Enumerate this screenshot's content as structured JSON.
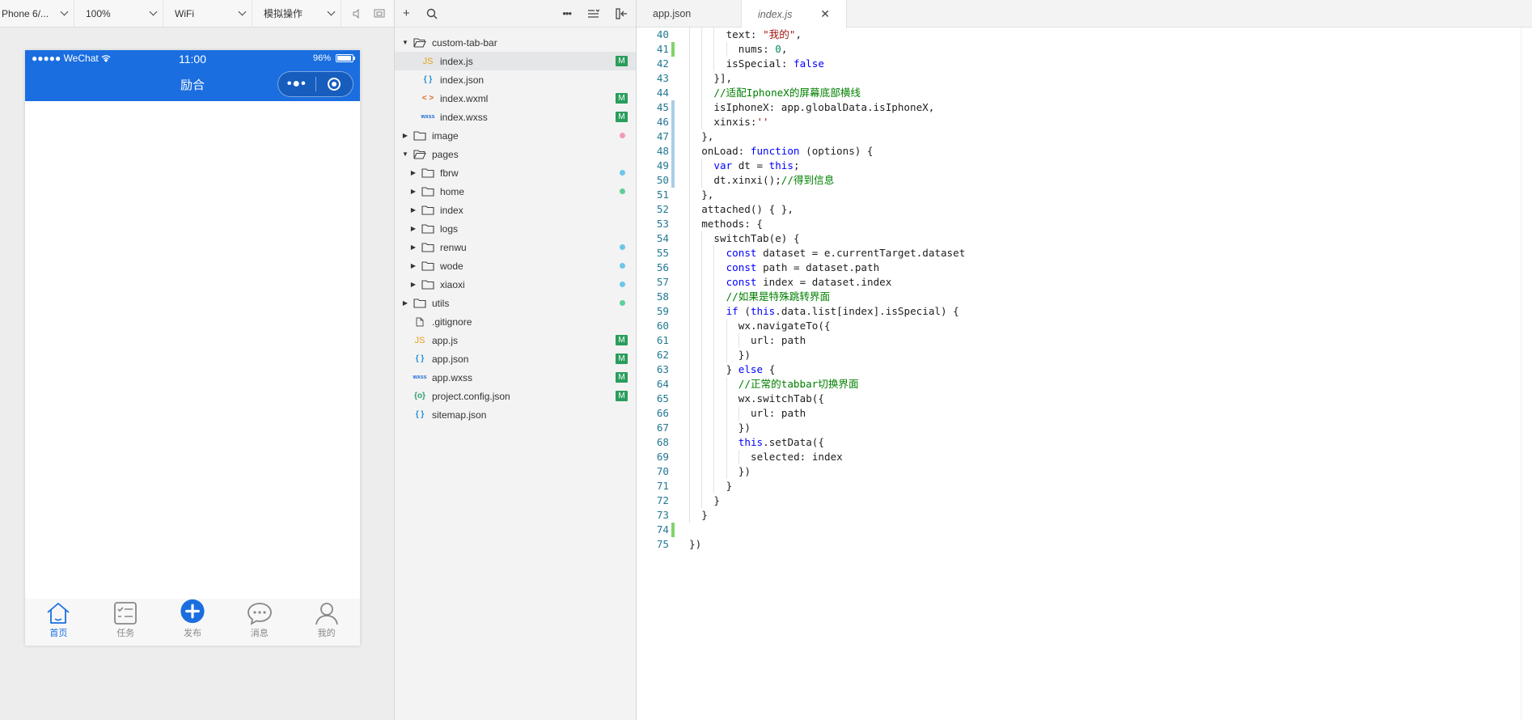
{
  "simulator": {
    "device": "Phone 6/...",
    "zoom": "100%",
    "network": "WiFi",
    "mode": "模拟操作",
    "status_bar": {
      "carrier": "●●●●● WeChat",
      "time": "11:00",
      "battery": "96%"
    },
    "nav_title": "励合",
    "tabbar": [
      {
        "label": "首页",
        "icon": "home-icon",
        "active": true
      },
      {
        "label": "任务",
        "icon": "task-list-icon",
        "active": false
      },
      {
        "label": "发布",
        "icon": "plus-circle-icon",
        "active": false,
        "special": true
      },
      {
        "label": "消息",
        "icon": "chat-bubble-icon",
        "active": false
      },
      {
        "label": "我的",
        "icon": "user-icon",
        "active": false
      }
    ]
  },
  "explorer": {
    "tree": [
      {
        "name": "custom-tab-bar",
        "type": "folder",
        "depth": 0,
        "open": true
      },
      {
        "name": "index.js",
        "type": "js",
        "depth": 1,
        "badge": "M",
        "selected": true
      },
      {
        "name": "index.json",
        "type": "json",
        "depth": 1
      },
      {
        "name": "index.wxml",
        "type": "wxml",
        "depth": 1,
        "badge": "M"
      },
      {
        "name": "index.wxss",
        "type": "wxss",
        "depth": 1,
        "badge": "M"
      },
      {
        "name": "image",
        "type": "folder",
        "depth": 0,
        "open": false,
        "dot": "#f29bb4"
      },
      {
        "name": "pages",
        "type": "folder",
        "depth": 0,
        "open": true
      },
      {
        "name": "fbrw",
        "type": "folder",
        "depth": 1,
        "open": false,
        "dot": "#6ec6e8"
      },
      {
        "name": "home",
        "type": "folder",
        "depth": 1,
        "open": false,
        "dot": "#5fcf9a"
      },
      {
        "name": "index",
        "type": "folder",
        "depth": 1,
        "open": false
      },
      {
        "name": "logs",
        "type": "folder",
        "depth": 1,
        "open": false
      },
      {
        "name": "renwu",
        "type": "folder",
        "depth": 1,
        "open": false,
        "dot": "#6ec6e8"
      },
      {
        "name": "wode",
        "type": "folder",
        "depth": 1,
        "open": false,
        "dot": "#6ec6e8"
      },
      {
        "name": "xiaoxi",
        "type": "folder",
        "depth": 1,
        "open": false,
        "dot": "#6ec6e8"
      },
      {
        "name": "utils",
        "type": "folder",
        "depth": 0,
        "open": false,
        "dot": "#5fcf9a"
      },
      {
        "name": ".gitignore",
        "type": "doc",
        "depth": 0
      },
      {
        "name": "app.js",
        "type": "js",
        "depth": 0,
        "badge": "M"
      },
      {
        "name": "app.json",
        "type": "json",
        "depth": 0,
        "badge": "M"
      },
      {
        "name": "app.wxss",
        "type": "wxss",
        "depth": 0,
        "badge": "M"
      },
      {
        "name": "project.config.json",
        "type": "config",
        "depth": 0,
        "badge": "M"
      },
      {
        "name": "sitemap.json",
        "type": "json",
        "depth": 0
      }
    ]
  },
  "editor": {
    "tabs": [
      {
        "label": "app.json",
        "active": false
      },
      {
        "label": "index.js",
        "active": true
      }
    ],
    "lines": [
      {
        "n": 40,
        "indent": 6,
        "mark": "",
        "tokens": [
          [
            "text: ",
            "p"
          ],
          [
            "\"我的\"",
            "s"
          ],
          [
            ",",
            "p"
          ]
        ]
      },
      {
        "n": 41,
        "indent": 8,
        "mark": "add",
        "tokens": [
          [
            "nums: ",
            "p"
          ],
          [
            "0",
            "n"
          ],
          [
            ",",
            "p"
          ]
        ]
      },
      {
        "n": 42,
        "indent": 6,
        "mark": "",
        "tokens": [
          [
            "isSpecial: ",
            "p"
          ],
          [
            "false",
            "k"
          ]
        ]
      },
      {
        "n": 43,
        "indent": 4,
        "mark": "",
        "tokens": [
          [
            "}],",
            "p"
          ]
        ]
      },
      {
        "n": 44,
        "indent": 4,
        "mark": "",
        "tokens": [
          [
            "//适配IphoneX的屏幕底部横线",
            "c"
          ]
        ]
      },
      {
        "n": 45,
        "indent": 4,
        "mark": "mod",
        "tokens": [
          [
            "isIphoneX: app.globalData.isIphoneX,",
            "p"
          ]
        ]
      },
      {
        "n": 46,
        "indent": 4,
        "mark": "mod",
        "tokens": [
          [
            "xinxis:",
            "p"
          ],
          [
            "''",
            "s"
          ]
        ]
      },
      {
        "n": 47,
        "indent": 2,
        "mark": "mod",
        "tokens": [
          [
            "},",
            "p"
          ]
        ]
      },
      {
        "n": 48,
        "indent": 2,
        "mark": "mod",
        "tokens": [
          [
            "onLoad: ",
            "p"
          ],
          [
            "function",
            "k"
          ],
          [
            " (options) {",
            "p"
          ]
        ]
      },
      {
        "n": 49,
        "indent": 4,
        "mark": "mod",
        "tokens": [
          [
            "var",
            "k"
          ],
          [
            " dt = ",
            "p"
          ],
          [
            "this",
            "k"
          ],
          [
            ";",
            "p"
          ]
        ]
      },
      {
        "n": 50,
        "indent": 4,
        "mark": "mod",
        "tokens": [
          [
            "dt.xinxi();",
            "p"
          ],
          [
            "//得到信息",
            "c"
          ]
        ]
      },
      {
        "n": 51,
        "indent": 2,
        "mark": "",
        "tokens": [
          [
            "},",
            "p"
          ]
        ]
      },
      {
        "n": 52,
        "indent": 2,
        "mark": "",
        "tokens": [
          [
            "attached() { },",
            "p"
          ]
        ]
      },
      {
        "n": 53,
        "indent": 2,
        "mark": "",
        "tokens": [
          [
            "methods: {",
            "p"
          ]
        ]
      },
      {
        "n": 54,
        "indent": 4,
        "mark": "",
        "tokens": [
          [
            "switchTab(e) {",
            "p"
          ]
        ]
      },
      {
        "n": 55,
        "indent": 6,
        "mark": "",
        "tokens": [
          [
            "const",
            "k"
          ],
          [
            " dataset = e.currentTarget.dataset",
            "p"
          ]
        ]
      },
      {
        "n": 56,
        "indent": 6,
        "mark": "",
        "tokens": [
          [
            "const",
            "k"
          ],
          [
            " path = dataset.path",
            "p"
          ]
        ]
      },
      {
        "n": 57,
        "indent": 6,
        "mark": "",
        "tokens": [
          [
            "const",
            "k"
          ],
          [
            " index = dataset.index",
            "p"
          ]
        ]
      },
      {
        "n": 58,
        "indent": 6,
        "mark": "",
        "tokens": [
          [
            "//如果是特殊跳转界面",
            "c"
          ]
        ]
      },
      {
        "n": 59,
        "indent": 6,
        "mark": "",
        "tokens": [
          [
            "if",
            "k"
          ],
          [
            " (",
            "p"
          ],
          [
            "this",
            "k"
          ],
          [
            ".data.list[index].isSpecial) {",
            "p"
          ]
        ]
      },
      {
        "n": 60,
        "indent": 8,
        "mark": "",
        "tokens": [
          [
            "wx.navigateTo({",
            "p"
          ]
        ]
      },
      {
        "n": 61,
        "indent": 10,
        "mark": "",
        "tokens": [
          [
            "url: path",
            "p"
          ]
        ]
      },
      {
        "n": 62,
        "indent": 8,
        "mark": "",
        "tokens": [
          [
            "})",
            "p"
          ]
        ]
      },
      {
        "n": 63,
        "indent": 6,
        "mark": "",
        "tokens": [
          [
            "} ",
            "p"
          ],
          [
            "else",
            "k"
          ],
          [
            " {",
            "p"
          ]
        ]
      },
      {
        "n": 64,
        "indent": 8,
        "mark": "",
        "tokens": [
          [
            "//正常的tabbar切换界面",
            "c"
          ]
        ]
      },
      {
        "n": 65,
        "indent": 8,
        "mark": "",
        "tokens": [
          [
            "wx.switchTab({",
            "p"
          ]
        ]
      },
      {
        "n": 66,
        "indent": 10,
        "mark": "",
        "tokens": [
          [
            "url: path",
            "p"
          ]
        ]
      },
      {
        "n": 67,
        "indent": 8,
        "mark": "",
        "tokens": [
          [
            "})",
            "p"
          ]
        ]
      },
      {
        "n": 68,
        "indent": 8,
        "mark": "",
        "tokens": [
          [
            "this",
            "k"
          ],
          [
            ".setData({",
            "p"
          ]
        ]
      },
      {
        "n": 69,
        "indent": 10,
        "mark": "",
        "tokens": [
          [
            "selected: index",
            "p"
          ]
        ]
      },
      {
        "n": 70,
        "indent": 8,
        "mark": "",
        "tokens": [
          [
            "})",
            "p"
          ]
        ]
      },
      {
        "n": 71,
        "indent": 6,
        "mark": "",
        "tokens": [
          [
            "}",
            "p"
          ]
        ]
      },
      {
        "n": 72,
        "indent": 4,
        "mark": "",
        "tokens": [
          [
            "}",
            "p"
          ]
        ]
      },
      {
        "n": 73,
        "indent": 2,
        "mark": "",
        "tokens": [
          [
            "}",
            "p"
          ]
        ]
      },
      {
        "n": 74,
        "indent": 0,
        "mark": "add",
        "tokens": []
      },
      {
        "n": 75,
        "indent": 0,
        "mark": "",
        "tokens": [
          [
            "})",
            "p"
          ]
        ]
      }
    ],
    "token_colors": {
      "p": "#1e1e1e",
      "k": "#0000ff",
      "s": "#a31515",
      "c": "#008000",
      "n": "#098658"
    }
  }
}
